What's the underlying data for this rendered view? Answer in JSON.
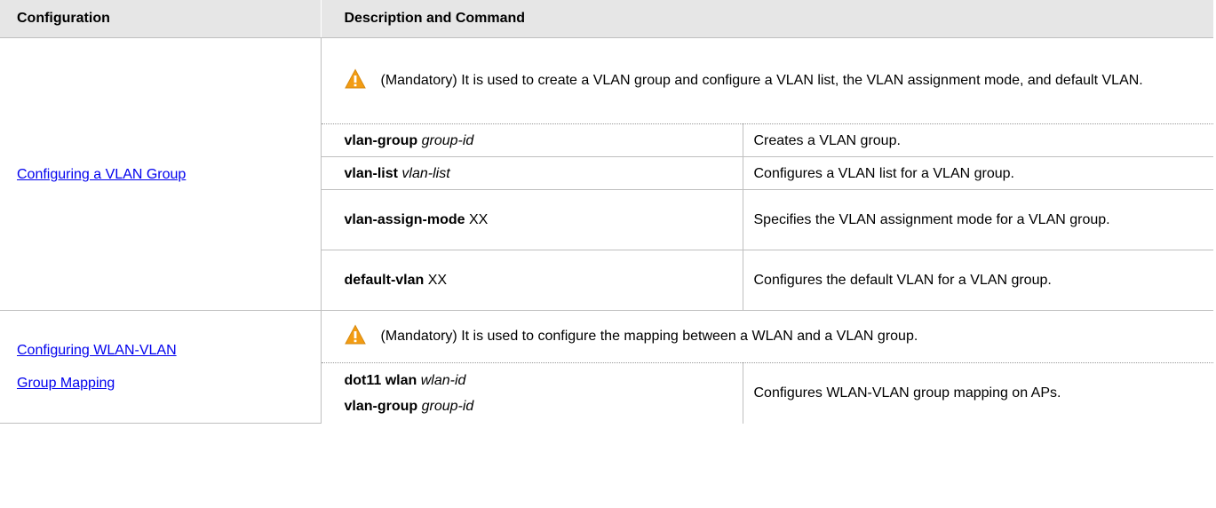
{
  "header": {
    "col1": "Configuration",
    "col2": "Description and Command"
  },
  "sections": [
    {
      "link": "Configuring a VLAN Group",
      "note": "(Mandatory) It is used to create a VLAN group and configure a VLAN list, the VLAN assignment mode, and default VLAN.",
      "rows": [
        {
          "kw": "vlan-group",
          "arg": "group-id",
          "desc": "Creates a VLAN group."
        },
        {
          "kw": "vlan-list",
          "arg": "vlan-list",
          "desc": "Configures a VLAN list for a VLAN group."
        },
        {
          "kw": "vlan-assign-mode",
          "plain": "XX",
          "desc": "Specifies the VLAN assignment mode for a VLAN group."
        },
        {
          "kw": "default-vlan",
          "plain": "XX",
          "desc": "Configures the default VLAN for a VLAN group."
        }
      ]
    },
    {
      "link_line1": "Configuring WLAN-VLAN",
      "link_line2": "Group Mapping",
      "note": "(Mandatory) It is used to configure the mapping between a WLAN and a VLAN group.",
      "rows": [
        {
          "kw1": "dot11 wlan",
          "arg1": "wlan-id",
          "kw2": "vlan-group",
          "arg2": "group-id",
          "desc": "Configures WLAN-VLAN group mapping on APs."
        }
      ]
    }
  ],
  "icons": {
    "note": "warning-icon"
  },
  "colors": {
    "link": "#0000ee",
    "header_bg": "#e6e6e6",
    "warning_fill": "#f39c12"
  }
}
